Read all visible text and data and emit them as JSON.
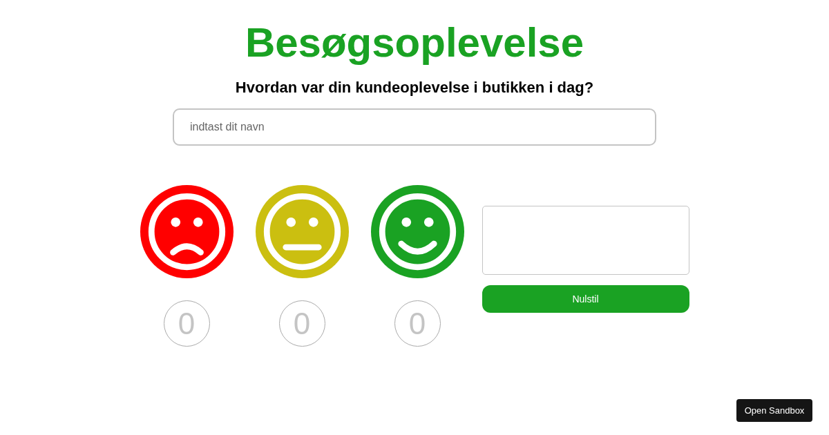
{
  "title": "Besøgsoplevelse",
  "question": "Hvordan var din kundeoplevelse i butikken i dag?",
  "name_field": {
    "placeholder": "indtast dit navn"
  },
  "ratings": [
    {
      "kind": "sad",
      "color": "#ff0000",
      "count": "0"
    },
    {
      "kind": "neutral",
      "color": "#cbbf10",
      "count": "0"
    },
    {
      "kind": "happy",
      "color": "#1aa223",
      "count": "0"
    }
  ],
  "reset_button": "Nulstil",
  "sandbox_button": "Open Sandbox"
}
